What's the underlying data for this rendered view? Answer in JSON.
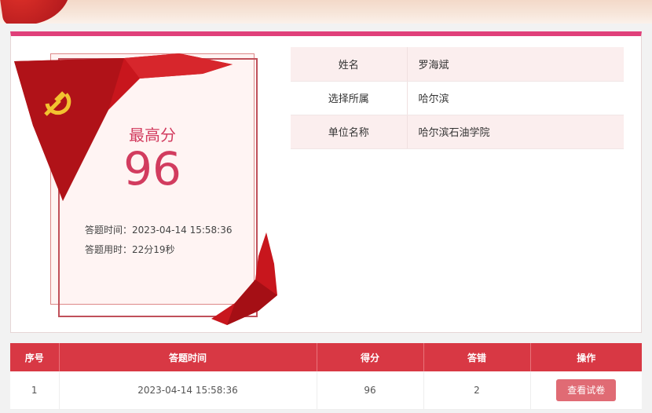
{
  "banner": {
    "title_fragment": ""
  },
  "score_card": {
    "label": "最高分",
    "value": "96",
    "answer_time_label": "答题时间：",
    "answer_time": "2023-04-14 15:58:36",
    "duration_label": "答题用时：",
    "duration": "22分19秒"
  },
  "info": {
    "rows": [
      {
        "key": "姓名",
        "value": "罗海斌"
      },
      {
        "key": "选择所属",
        "value": "哈尔滨"
      },
      {
        "key": "单位名称",
        "value": "哈尔滨石油学院"
      }
    ]
  },
  "records": {
    "headers": [
      "序号",
      "答题时间",
      "得分",
      "答错",
      "操作"
    ],
    "rows": [
      {
        "index": "1",
        "time": "2023-04-14 15:58:36",
        "score": "96",
        "wrong": "2",
        "action": "查看试卷"
      }
    ]
  },
  "colors": {
    "accent": "#d83844",
    "score": "#d23c5f",
    "flag": "#c8161d",
    "emblem": "#f2c230"
  }
}
